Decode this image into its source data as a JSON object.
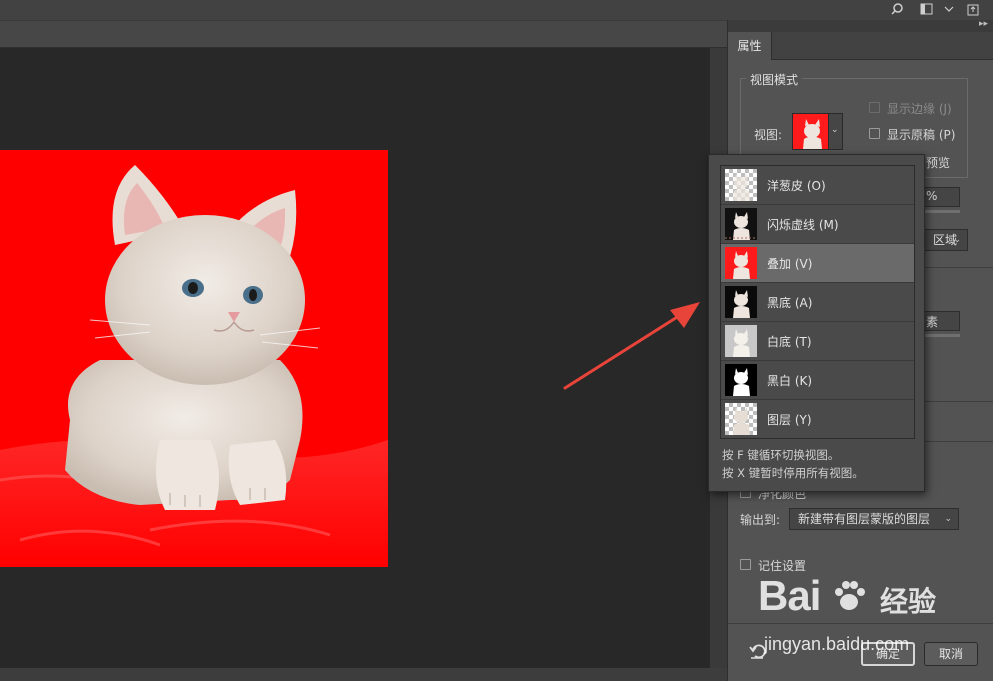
{
  "panel": {
    "tab_label": "属性",
    "view_mode": {
      "group_title": "视图模式",
      "view_label": "视图:",
      "show_edge_label": "显示边缘 (J)",
      "show_edge_checked": false,
      "show_original_label": "显示原稿 (P)",
      "show_original_checked": false,
      "partial_preview": "预览"
    },
    "partial_percent": "%",
    "partial_region": "区域",
    "partial_pixel": "素",
    "decontaminate_label": "净化颜色",
    "output_to_label": "输出到:",
    "output_to_value": "新建带有图层蒙版的图层",
    "remember_label": "记住设置",
    "ok_label": "确定",
    "cancel_label": "取消"
  },
  "view_popup": {
    "items": [
      {
        "label": "洋葱皮 (O)",
        "style": "onion",
        "selected": false
      },
      {
        "label": "闪烁虚线 (M)",
        "style": "marching",
        "selected": false
      },
      {
        "label": "叠加 (V)",
        "style": "overlay",
        "selected": true
      },
      {
        "label": "黑底 (A)",
        "style": "onblack",
        "selected": false
      },
      {
        "label": "白底 (T)",
        "style": "onwhite",
        "selected": false
      },
      {
        "label": "黑白 (K)",
        "style": "bw",
        "selected": false
      },
      {
        "label": "图层 (Y)",
        "style": "layers",
        "selected": false
      }
    ],
    "hint_1": "按 F 键循环切换视图。",
    "hint_2": "按 X 键暂时停用所有视图。"
  },
  "colors": {
    "overlay_red": "#ff0000",
    "arrow": "#e8443a"
  },
  "watermark": {
    "brand": "Bai",
    "brand_du": "du",
    "cn": "经验",
    "url": "jingyan.baidu.com"
  }
}
